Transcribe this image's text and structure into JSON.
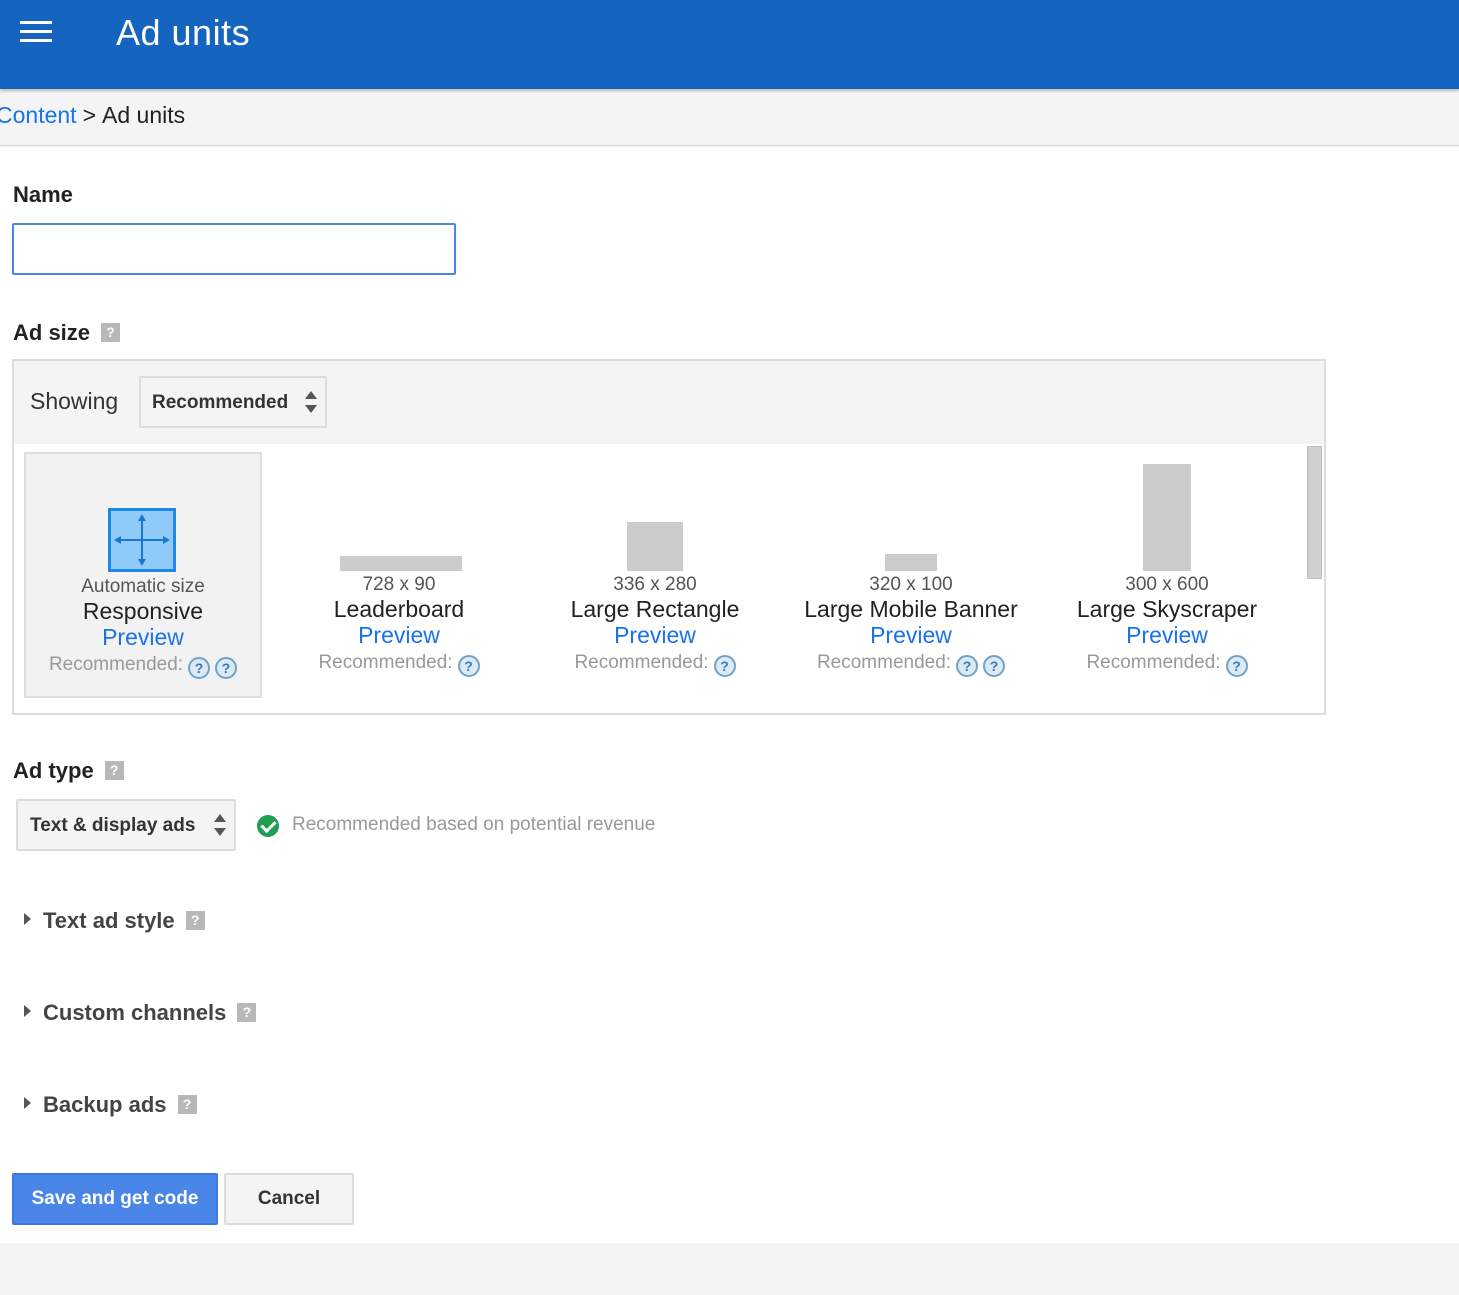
{
  "header": {
    "title": "Ad units"
  },
  "breadcrumb": {
    "parent": "Content",
    "separator": ">",
    "current": "Ad units"
  },
  "form": {
    "name": {
      "label": "Name",
      "value": ""
    },
    "ad_size": {
      "label": "Ad size",
      "help": "?",
      "showing_label": "Showing",
      "showing_value": "Recommended",
      "sizes": [
        {
          "dims": "Automatic size",
          "name": "Responsive",
          "preview": "Preview",
          "recommended": "Recommended:",
          "selected": true
        },
        {
          "dims": "728 x 90",
          "name": "Leaderboard",
          "preview": "Preview",
          "recommended": "Recommended:"
        },
        {
          "dims": "336 x 280",
          "name": "Large Rectangle",
          "preview": "Preview",
          "recommended": "Recommended:"
        },
        {
          "dims": "320 x 100",
          "name": "Large Mobile Banner",
          "preview": "Preview",
          "recommended": "Recommended:"
        },
        {
          "dims": "300 x 600",
          "name": "Large Skyscraper",
          "preview": "Preview",
          "recommended": "Recommended:"
        }
      ],
      "question_mark": "?"
    },
    "ad_type": {
      "label": "Ad type",
      "help": "?",
      "value": "Text & display ads",
      "note": "Recommended based on potential revenue"
    },
    "sections": [
      {
        "label": "Text ad style",
        "help": "?"
      },
      {
        "label": "Custom channels",
        "help": "?"
      },
      {
        "label": "Backup ads",
        "help": "?"
      }
    ],
    "buttons": {
      "save": "Save and get code",
      "cancel": "Cancel"
    }
  },
  "colors": {
    "header_bg": "#1565c0",
    "link": "#1a73e8",
    "primary_button": "#4a86e8",
    "check": "#1e9e50"
  }
}
